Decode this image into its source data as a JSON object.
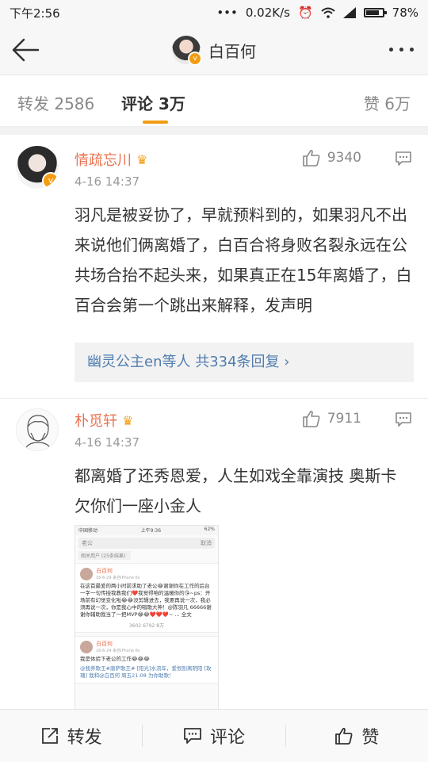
{
  "status_bar": {
    "time": "下午2:56",
    "dots": "•••",
    "speed": "0.02K/s",
    "battery": "78%"
  },
  "header": {
    "title": "白百何"
  },
  "tabs": {
    "repost": "转发 2586",
    "comment": "评论 3万",
    "like": "赞 6万"
  },
  "comments": [
    {
      "name": "情疏忘川",
      "time": "4-16 14:37",
      "likes": "9340",
      "text": "羽凡是被妥协了，早就预料到的，如果羽凡不出来说他们俩离婚了，白百合将身败名裂永远在公共场合抬不起头来，如果真正在15年离婚了，白百合会第一个跳出来解释，发声明",
      "replies": "幽灵公主en等人  共334条回复 ›"
    },
    {
      "name": "朴觅轩",
      "time": "4-16 14:37",
      "likes": "7911",
      "text": "都离婚了还秀恩爱，人生如戏全靠演技 奥斯卡欠你们一座小金人"
    }
  ],
  "embedded_screenshot": {
    "carrier": "中国移动",
    "time": "上午9:36",
    "battery": "62%",
    "search": "老公",
    "cancel": "取消",
    "chip": "相关用户 (25条结果)",
    "post1_name": "白百何",
    "post1_meta": "16-6-29  来自iPhone 6s",
    "post1_body": "在这首最爱的两小时前求助了老公😂谢谢你在工作的后台一字一句传授我教我们❤️我觉得咱的温暖你的😘~ps：开场前有幻觉变化啦😂😂没剪辑进去，我要再说一次，我必须再说一次，你是我心中的唱歌大神！@陈羽凡 66666谢谢你辅助我当了一把MVP😂😂❤️❤️❤️~ ... 全文",
    "post1_counts": "3602   6792   8万",
    "post2_name": "白百何",
    "post2_meta": "16-6-24  来自iPhone 6s",
    "post2_body": "我是体验下老公的工作😂😂😂",
    "post2_footer": "@我养歌王#唐萨歌王# [阳光]水流年，爱恨别离阴阳 [玫瑰] 我和@白百何 周五21:08 为你助歌！"
  },
  "bottom_bar": {
    "repost": "转发",
    "comment": "评论",
    "like": "赞"
  }
}
